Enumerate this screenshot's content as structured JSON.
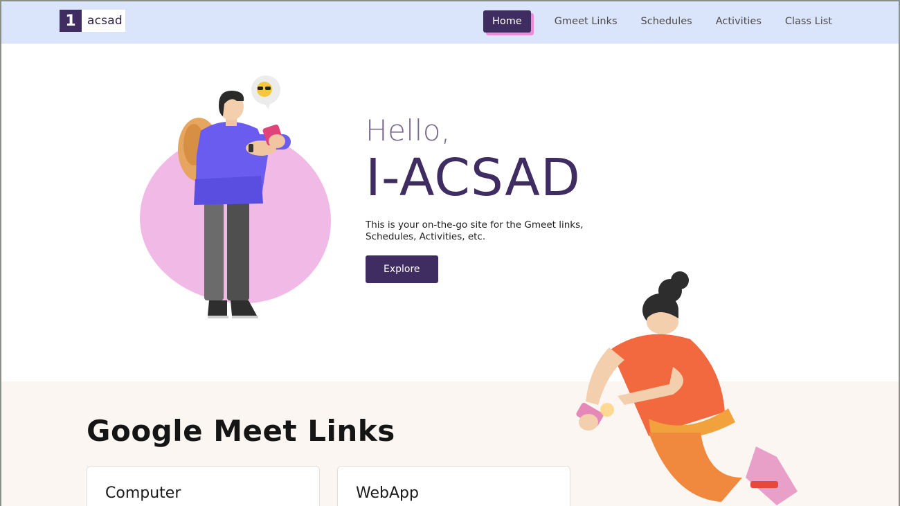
{
  "brand": {
    "number": "1",
    "name": "acsad"
  },
  "nav": {
    "items": [
      {
        "label": "Home",
        "active": true
      },
      {
        "label": "Gmeet Links",
        "active": false
      },
      {
        "label": "Schedules",
        "active": false
      },
      {
        "label": "Activities",
        "active": false
      },
      {
        "label": "Class List",
        "active": false
      }
    ]
  },
  "hero": {
    "greeting": "Hello,",
    "title": "I-ACSAD",
    "tagline": "This is your on-the-go site for the Gmeet links, Schedules, Activities, etc.",
    "button_label": "Explore"
  },
  "gmeet": {
    "title": "Google Meet Links",
    "cards": [
      {
        "title": "Computer"
      },
      {
        "title": "WebApp"
      }
    ]
  },
  "colors": {
    "primary": "#3f2d61",
    "navbar_bg": "#dae4fb",
    "accent_shadow": "#e88ed6",
    "blob": "#f1b9e6",
    "section_bg": "#fcf6f3"
  },
  "icons": {
    "hero_illustration": "person-with-phone-illustration",
    "emoji_bubble": "sunglasses-emoji-icon",
    "girl_illustration": "girl-with-phone-illustration"
  }
}
